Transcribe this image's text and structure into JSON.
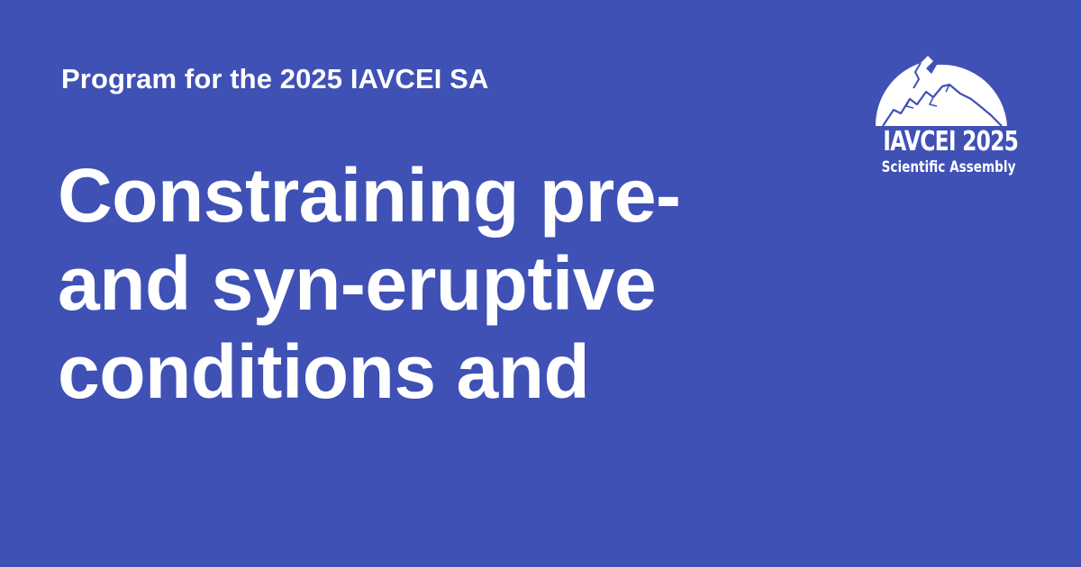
{
  "card": {
    "background_color": "#3f51b5",
    "text_color": "#ffffff",
    "subtitle": "Program for the 2025 IAVCEI SA",
    "title_lines": [
      "Constraining pre-",
      "and syn-eruptive",
      "conditions and"
    ]
  },
  "logo": {
    "icon": "volcano-mountain-icon",
    "name": "IAVCEI 2025",
    "tagline": "Scientific Assembly"
  }
}
